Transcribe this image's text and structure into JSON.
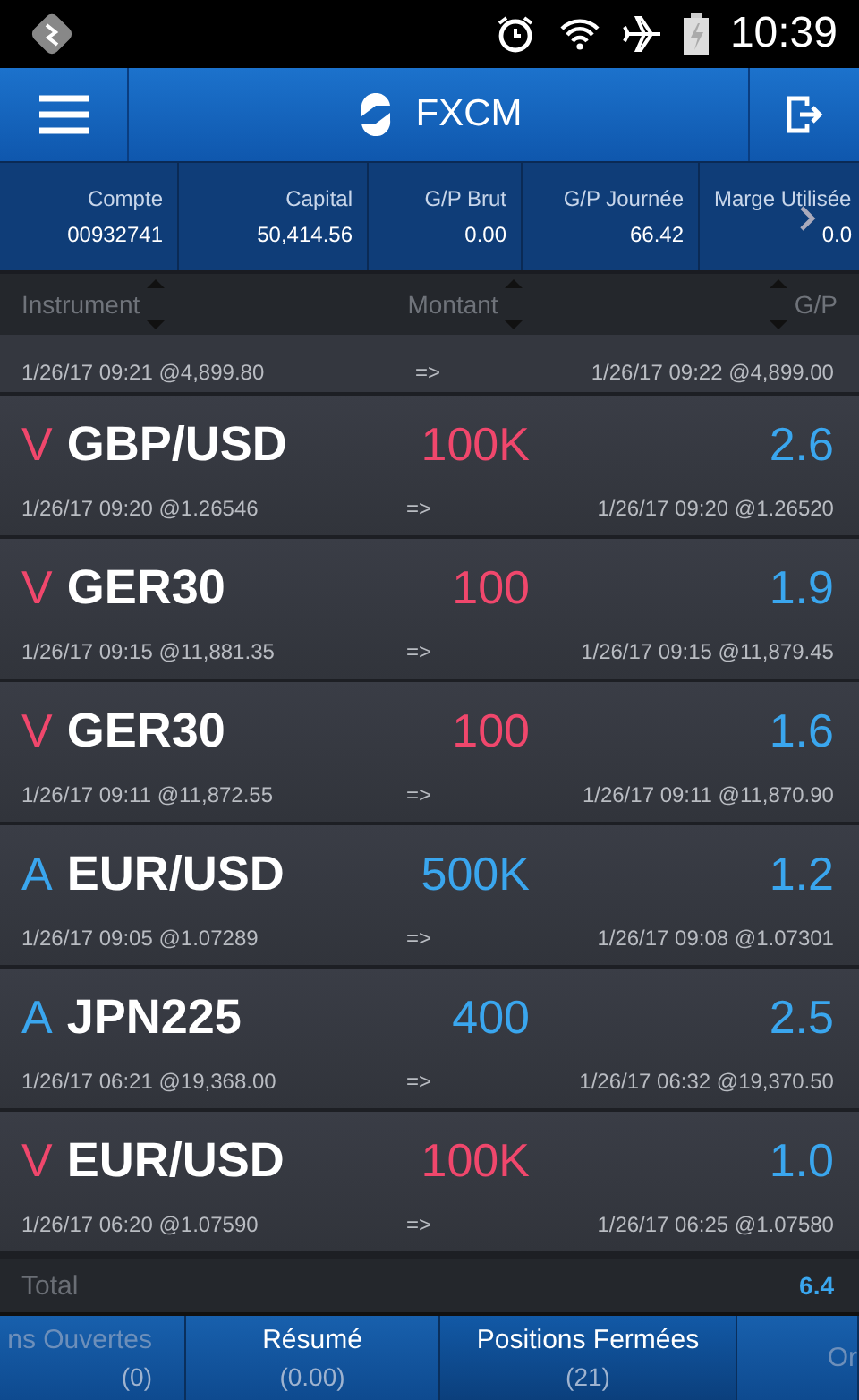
{
  "status_bar": {
    "time": "10:39"
  },
  "header": {
    "title": "FXCM"
  },
  "summary": [
    {
      "label": "Compte",
      "value": "00932741"
    },
    {
      "label": "Capital",
      "value": "50,414.56"
    },
    {
      "label": "G/P Brut",
      "value": "0.00"
    },
    {
      "label": "G/P Journée",
      "value": "66.42"
    },
    {
      "label": "Marge Utilisée",
      "value": "0.0"
    }
  ],
  "table": {
    "columns": [
      "Instrument",
      "Montant",
      "G/P"
    ],
    "partial_row": {
      "open": "1/26/17 09:21 @4,899.80",
      "arrow": "=>",
      "close": "1/26/17 09:22 @4,899.00"
    },
    "rows": [
      {
        "side": "V",
        "kind": "sell",
        "instrument": "GBP/USD",
        "amount": "100K",
        "pl": "2.6",
        "open": "1/26/17 09:20 @1.26546",
        "arrow": "=>",
        "close": "1/26/17 09:20 @1.26520"
      },
      {
        "side": "V",
        "kind": "sell",
        "instrument": "GER30",
        "amount": "100",
        "pl": "1.9",
        "open": "1/26/17 09:15 @11,881.35",
        "arrow": "=>",
        "close": "1/26/17 09:15 @11,879.45"
      },
      {
        "side": "V",
        "kind": "sell",
        "instrument": "GER30",
        "amount": "100",
        "pl": "1.6",
        "open": "1/26/17 09:11 @11,872.55",
        "arrow": "=>",
        "close": "1/26/17 09:11 @11,870.90"
      },
      {
        "side": "A",
        "kind": "buy",
        "instrument": "EUR/USD",
        "amount": "500K",
        "pl": "1.2",
        "open": "1/26/17 09:05 @1.07289",
        "arrow": "=>",
        "close": "1/26/17 09:08 @1.07301"
      },
      {
        "side": "A",
        "kind": "buy",
        "instrument": "JPN225",
        "amount": "400",
        "pl": "2.5",
        "open": "1/26/17 06:21 @19,368.00",
        "arrow": "=>",
        "close": "1/26/17 06:32 @19,370.50"
      },
      {
        "side": "V",
        "kind": "sell",
        "instrument": "EUR/USD",
        "amount": "100K",
        "pl": "1.0",
        "open": "1/26/17 06:20 @1.07590",
        "arrow": "=>",
        "close": "1/26/17 06:25 @1.07580"
      }
    ],
    "total": {
      "label": "Total",
      "value": "6.4"
    }
  },
  "tabs": [
    {
      "label": "ns Ouvertes",
      "count": "(0)",
      "selected": false
    },
    {
      "label": "Résumé",
      "count": "(0.00)",
      "selected": false
    },
    {
      "label": "Positions Fermées",
      "count": "(21)",
      "selected": true
    },
    {
      "label": "Or",
      "selected": false
    }
  ]
}
